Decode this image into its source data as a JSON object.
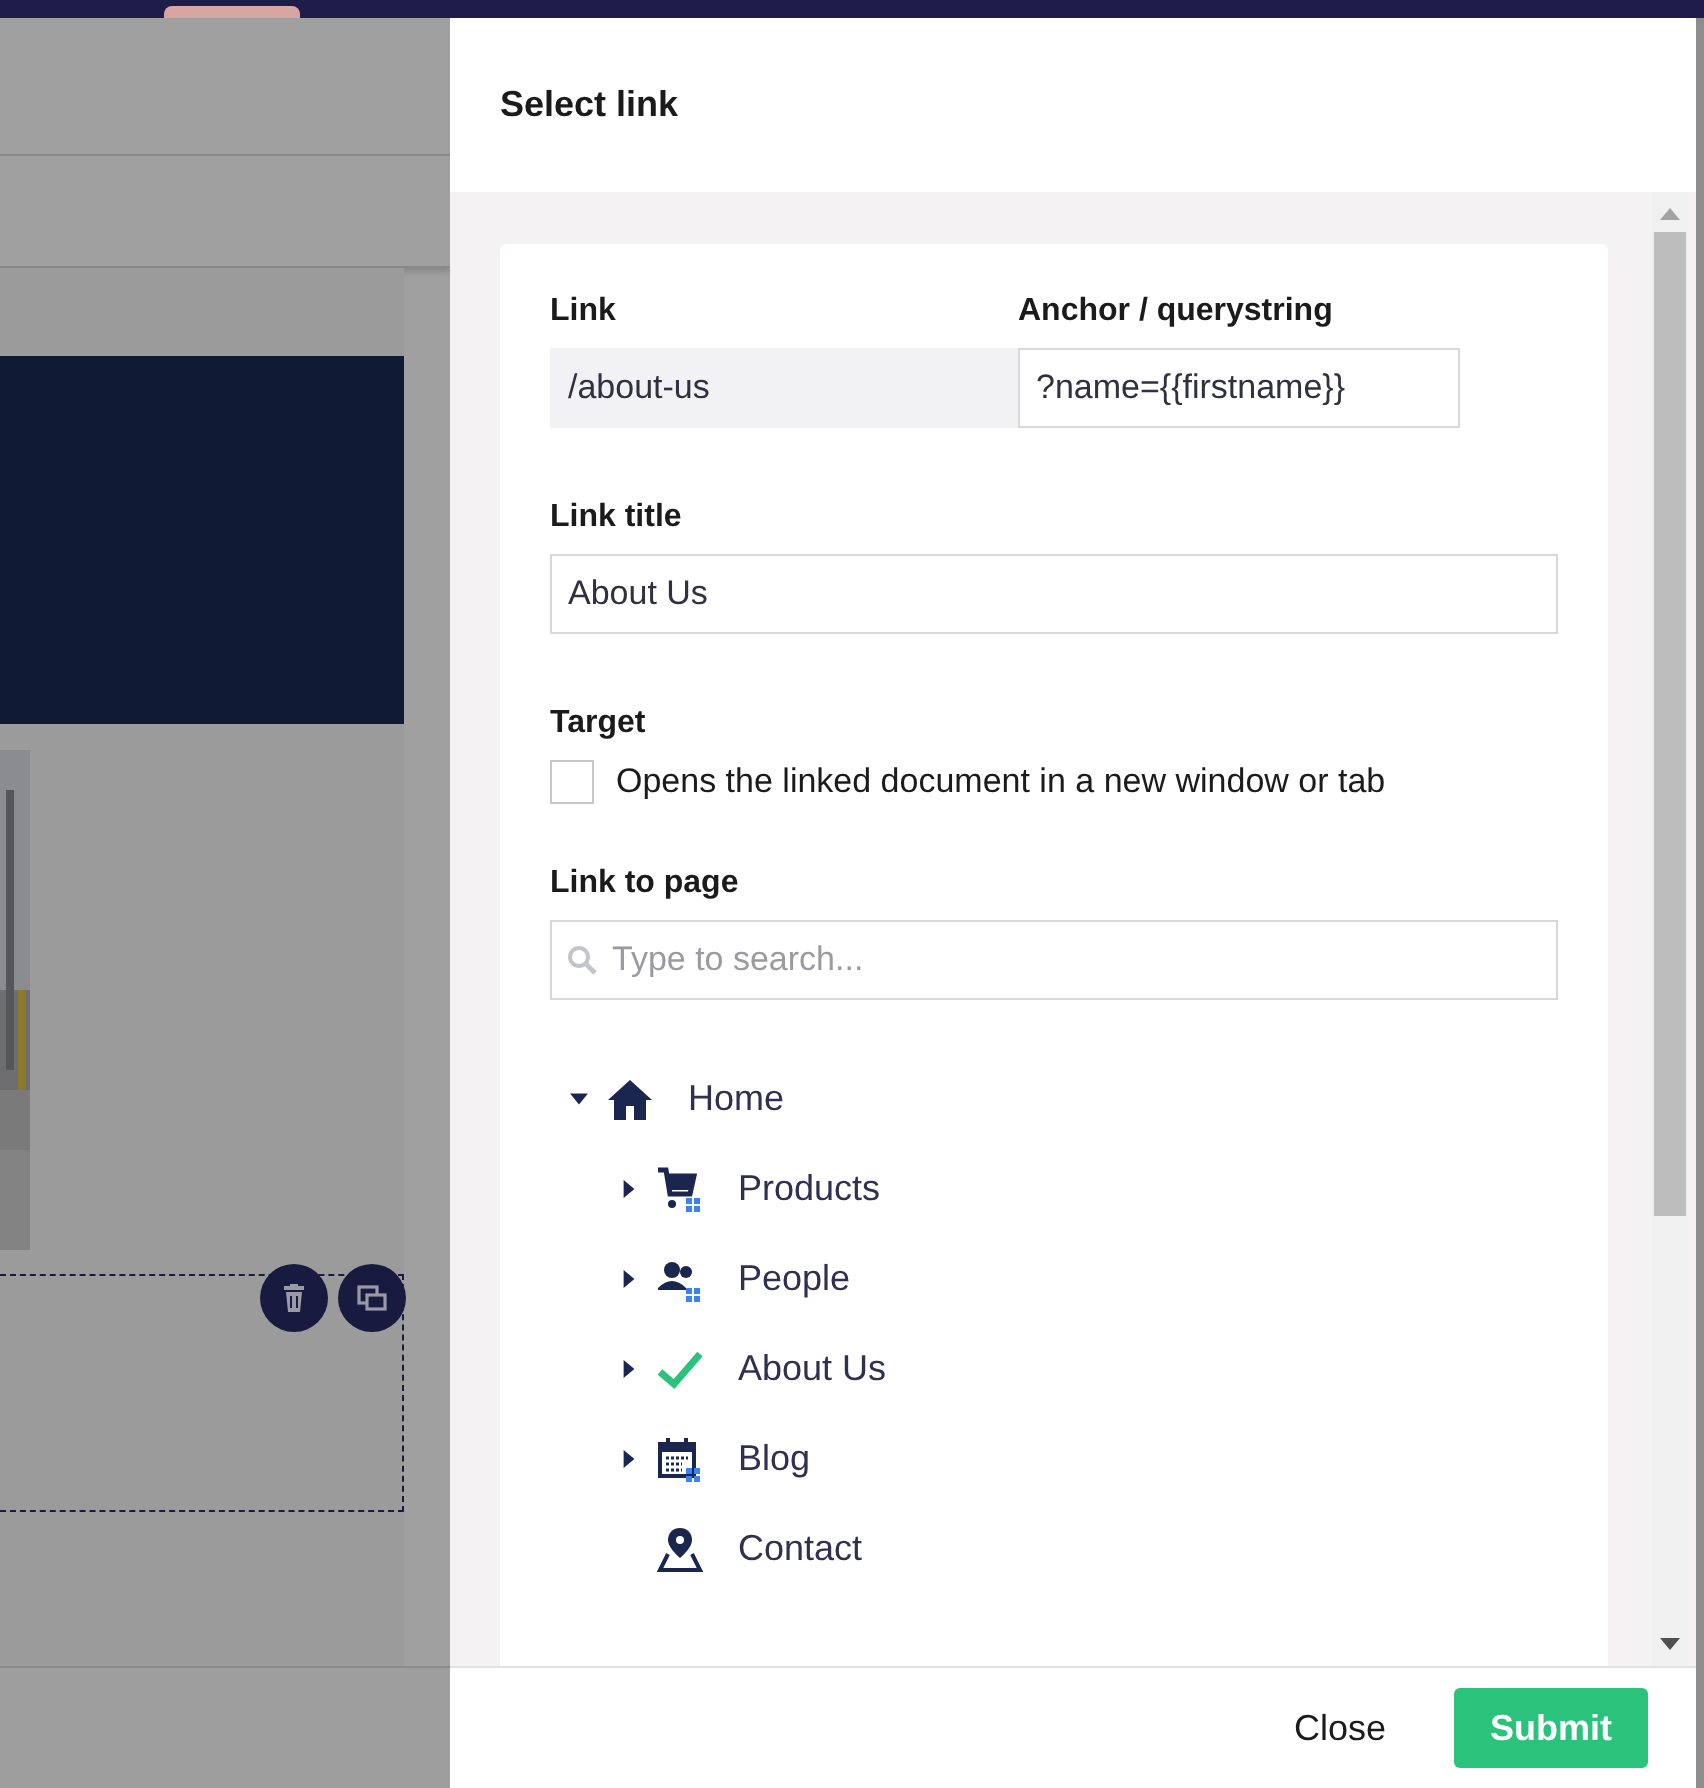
{
  "dialog": {
    "title": "Select link"
  },
  "link": {
    "label": "Link",
    "value": "/about-us",
    "disabled": true
  },
  "anchor": {
    "label": "Anchor / querystring",
    "value": "?name={{firstname}}"
  },
  "link_title": {
    "label": "Link title",
    "value": "About Us"
  },
  "target": {
    "label": "Target",
    "option": "Opens the linked document in a new window or tab",
    "checked": false
  },
  "link_to_page": {
    "label": "Link to page",
    "search_placeholder": "Type to search..."
  },
  "tree": [
    {
      "label": "Home",
      "kind": "home",
      "has_children": true,
      "expanded": true,
      "selected": false,
      "children": [
        {
          "label": "Products",
          "kind": "cart",
          "has_children": true,
          "expanded": false,
          "selected": false
        },
        {
          "label": "People",
          "kind": "people",
          "has_children": true,
          "expanded": false,
          "selected": false
        },
        {
          "label": "About Us",
          "has_children": true,
          "expanded": false,
          "selected": true
        },
        {
          "label": "Blog",
          "kind": "calendar",
          "has_children": true,
          "expanded": false,
          "selected": false
        },
        {
          "label": "Contact",
          "kind": "pin",
          "has_children": false,
          "expanded": false,
          "selected": false
        }
      ]
    }
  ],
  "buttons": [
    {
      "label": "Close",
      "kind": "plain"
    },
    {
      "label": "Submit",
      "kind": "primary"
    }
  ]
}
